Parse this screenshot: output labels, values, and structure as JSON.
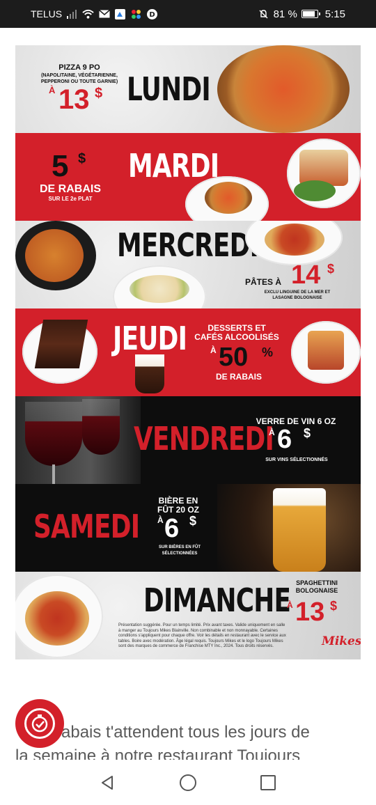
{
  "status_bar": {
    "carrier": "TELUS",
    "battery": "81 %",
    "time": "5:15"
  },
  "flyer": {
    "monday": {
      "item_line1": "PIZZA 9 PO",
      "item_line2": "(NAPOLITAINE, VÉGÉTARIENNE,",
      "item_line3": "PEPPERONI OU TOUTE GARNIE)",
      "price_prefix": "À",
      "price": "13",
      "currency": "$",
      "day": "LUNDI"
    },
    "tuesday": {
      "amount": "5",
      "currency": "$",
      "label": "DE RABAIS",
      "sub": "SUR LE 2e PLAT",
      "day": "MARDI"
    },
    "wednesday": {
      "day": "MERCREDI",
      "label": "PÂTES À",
      "price": "14",
      "currency": "$",
      "sub1": "EXCLU LINGUINE DE LA MER ET",
      "sub2": "LASAGNE BOLOGNAISE"
    },
    "thursday": {
      "day": "JEUDI",
      "line1": "DESSERTS ET",
      "line2": "CAFÉS ALCOOLISÉS",
      "prefix": "À",
      "percent": "50",
      "percent_sign": "%",
      "label": "DE RABAIS"
    },
    "friday": {
      "day": "VENDREDI",
      "line1": "VERRE DE VIN 6 OZ",
      "prefix": "À",
      "price": "6",
      "currency": "$",
      "sub": "SUR VINS SÉLECTIONNÉS"
    },
    "saturday": {
      "day": "SAMEDI",
      "line1": "BIÈRE EN",
      "line2": "FÛT 20 OZ",
      "prefix": "À",
      "price": "6",
      "currency": "$",
      "sub1": "SUR BIÈRES EN FÛT",
      "sub2": "SÉLECTIONNÉES"
    },
    "sunday": {
      "day": "DIMANCHE",
      "line1": "SPAGHETTINI",
      "line2": "BOLOGNAISE",
      "prefix": "À",
      "price": "13",
      "currency": "$",
      "disclaimer": "Présentation suggérée. Pour un temps limité. Prix avant taxes. Valide uniquement en salle à manger au Toujours Mikes Blainville. Non combinable et non monnayable. Certaines conditions s'appliquent pour chaque offre. Voir les détails en restaurant avec le service aux tables. Boire avec modération. Âge légal requis. Toujours Mikes et le logo Toujours Mikes sont des marques de commerce de Franchise MTY Inc., 2024. Tous droits réservés.",
      "logo": "Mikes"
    }
  },
  "article": {
    "line1_visible": "abais t'attendent tous les jours de",
    "line2_visible": "la semaine à notre restaurant Toujours"
  },
  "colors": {
    "brand_red": "#d3202a",
    "status_bar": "#1c1c1c",
    "band_black": "#0d0d0d"
  },
  "icons": {
    "fab": "stopwatch-check-icon",
    "nav_back": "triangle-back-icon",
    "nav_home": "circle-home-icon",
    "nav_recents": "square-recents-icon"
  }
}
